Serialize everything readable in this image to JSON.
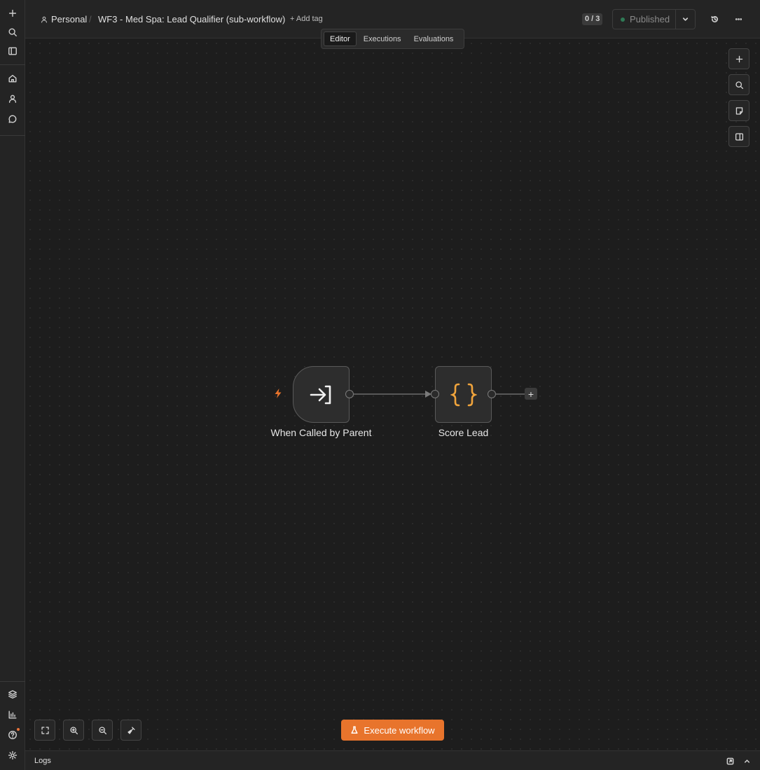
{
  "header": {
    "project": "Personal",
    "separator": "/",
    "workflow_title": "WF3 - Med Spa: Lead Qualifier (sub-workflow)",
    "add_tag": "+ Add tag",
    "counter": "0 / 3",
    "publish_state": "Published"
  },
  "tabs": [
    {
      "label": "Editor",
      "active": true
    },
    {
      "label": "Executions",
      "active": false
    },
    {
      "label": "Evaluations",
      "active": false
    }
  ],
  "nodes": [
    {
      "label": "When Called by Parent",
      "icon": "sign-in-arrow-icon",
      "type": "trigger"
    },
    {
      "label": "Score Lead",
      "icon": "curly-braces-icon",
      "type": "code"
    }
  ],
  "add_node_glyph": "+",
  "execute_button": {
    "label": "Execute workflow",
    "icon": "flask-icon"
  },
  "logs": {
    "label": "Logs"
  },
  "colors": {
    "accent": "#e8742c",
    "code_icon": "#f0a43c",
    "published_dot": "#2f7a55",
    "background": "#1d1d1d"
  }
}
